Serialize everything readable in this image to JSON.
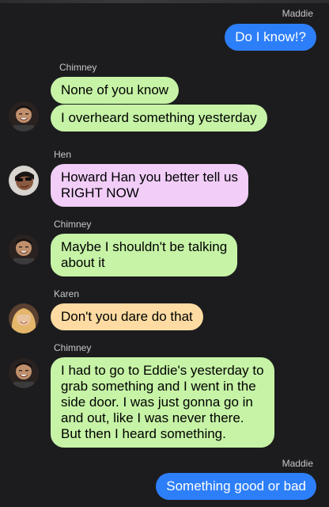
{
  "messages": [
    {
      "sender": "Maddie",
      "text": "Do I know!?",
      "style": "blue"
    },
    {
      "sender": "Chimney",
      "text": "None of you know",
      "style": "green"
    },
    {
      "text": "I overheard something yesterday",
      "style": "green"
    },
    {
      "sender": "Hen",
      "text": "Howard Han you better tell us\nRIGHT NOW",
      "style": "purple"
    },
    {
      "sender": "Chimney",
      "text": "Maybe I shouldn't be talking\nabout it",
      "style": "green"
    },
    {
      "sender": "Karen",
      "text": "Don't you dare do that",
      "style": "orange"
    },
    {
      "sender": "Chimney",
      "text": "I had to go to Eddie's yesterday to\ngrab something and I went in the\nside door. I was just gonna go in\nand out, like I was never there.\nBut then I heard something.",
      "style": "green"
    },
    {
      "sender": "Maddie",
      "text": "Something good or bad",
      "style": "blue"
    }
  ],
  "colors": {
    "background": "#1c1c1e",
    "blue_bubble": "#2d7ff9",
    "green_bubble": "#c6f3a6",
    "purple_bubble": "#f1cdf8",
    "orange_bubble": "#fddba2"
  }
}
